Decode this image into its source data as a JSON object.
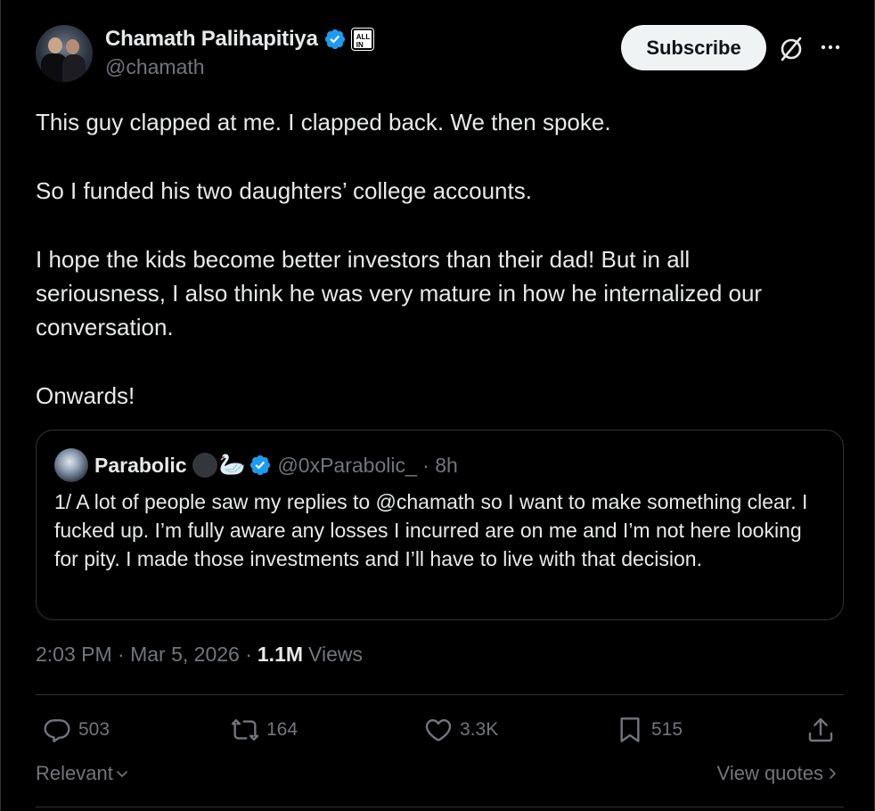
{
  "author": {
    "name": "Chamath Palihapitiya",
    "handle": "@chamath",
    "affiliate_badge": "ALL IN"
  },
  "header": {
    "subscribe_label": "Subscribe",
    "grok_icon": "grok-icon",
    "more_icon": "more-dots-icon"
  },
  "tweet": {
    "text": "This guy clapped at me. I clapped back. We then spoke.\n\nSo I funded his two daughters’ college accounts.\n\nI hope the kids become better investors than their dad! But in all\nseriousness, I also think he was very mature in how he internalized our\nconversation.\n\nOnwards!"
  },
  "quote": {
    "name": "Parabolic",
    "emoji": "🦢",
    "handle_time": "@0xParabolic_ · 8h",
    "text": "1/ A lot of people saw my replies to @chamath so I want to make something clear. I fucked up. I’m fully aware any losses I incurred are on me and I’m not here looking for pity. I made those investments and I’ll have to live with that decision."
  },
  "meta": {
    "timestamp": "2:03 PM · Mar 5, 2026 ·",
    "views_count": "1.1M",
    "views_label": "Views"
  },
  "actions": {
    "replies": "503",
    "reposts": "164",
    "likes": "3.3K",
    "bookmarks": "515"
  },
  "footer": {
    "sort_label": "Relevant",
    "quotes_label": "View quotes"
  },
  "colors": {
    "background": "#000000",
    "text": "#e7e9ea",
    "secondary": "#71767b",
    "border": "#2f3336",
    "verified": "#1d9bf0"
  }
}
